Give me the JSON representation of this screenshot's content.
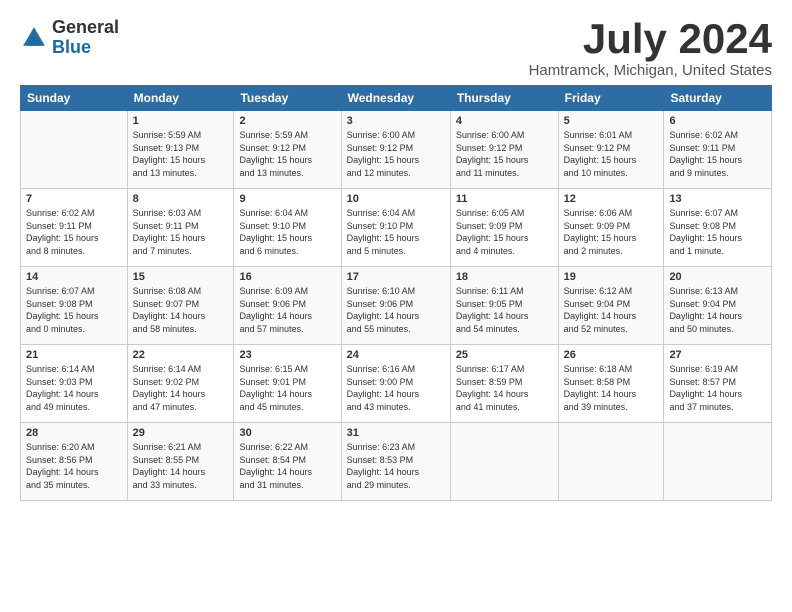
{
  "header": {
    "logo_general": "General",
    "logo_blue": "Blue",
    "month_title": "July 2024",
    "location": "Hamtramck, Michigan, United States"
  },
  "days_of_week": [
    "Sunday",
    "Monday",
    "Tuesday",
    "Wednesday",
    "Thursday",
    "Friday",
    "Saturday"
  ],
  "weeks": [
    [
      {
        "day": "",
        "content": ""
      },
      {
        "day": "1",
        "content": "Sunrise: 5:59 AM\nSunset: 9:13 PM\nDaylight: 15 hours\nand 13 minutes."
      },
      {
        "day": "2",
        "content": "Sunrise: 5:59 AM\nSunset: 9:12 PM\nDaylight: 15 hours\nand 13 minutes."
      },
      {
        "day": "3",
        "content": "Sunrise: 6:00 AM\nSunset: 9:12 PM\nDaylight: 15 hours\nand 12 minutes."
      },
      {
        "day": "4",
        "content": "Sunrise: 6:00 AM\nSunset: 9:12 PM\nDaylight: 15 hours\nand 11 minutes."
      },
      {
        "day": "5",
        "content": "Sunrise: 6:01 AM\nSunset: 9:12 PM\nDaylight: 15 hours\nand 10 minutes."
      },
      {
        "day": "6",
        "content": "Sunrise: 6:02 AM\nSunset: 9:11 PM\nDaylight: 15 hours\nand 9 minutes."
      }
    ],
    [
      {
        "day": "7",
        "content": "Sunrise: 6:02 AM\nSunset: 9:11 PM\nDaylight: 15 hours\nand 8 minutes."
      },
      {
        "day": "8",
        "content": "Sunrise: 6:03 AM\nSunset: 9:11 PM\nDaylight: 15 hours\nand 7 minutes."
      },
      {
        "day": "9",
        "content": "Sunrise: 6:04 AM\nSunset: 9:10 PM\nDaylight: 15 hours\nand 6 minutes."
      },
      {
        "day": "10",
        "content": "Sunrise: 6:04 AM\nSunset: 9:10 PM\nDaylight: 15 hours\nand 5 minutes."
      },
      {
        "day": "11",
        "content": "Sunrise: 6:05 AM\nSunset: 9:09 PM\nDaylight: 15 hours\nand 4 minutes."
      },
      {
        "day": "12",
        "content": "Sunrise: 6:06 AM\nSunset: 9:09 PM\nDaylight: 15 hours\nand 2 minutes."
      },
      {
        "day": "13",
        "content": "Sunrise: 6:07 AM\nSunset: 9:08 PM\nDaylight: 15 hours\nand 1 minute."
      }
    ],
    [
      {
        "day": "14",
        "content": "Sunrise: 6:07 AM\nSunset: 9:08 PM\nDaylight: 15 hours\nand 0 minutes."
      },
      {
        "day": "15",
        "content": "Sunrise: 6:08 AM\nSunset: 9:07 PM\nDaylight: 14 hours\nand 58 minutes."
      },
      {
        "day": "16",
        "content": "Sunrise: 6:09 AM\nSunset: 9:06 PM\nDaylight: 14 hours\nand 57 minutes."
      },
      {
        "day": "17",
        "content": "Sunrise: 6:10 AM\nSunset: 9:06 PM\nDaylight: 14 hours\nand 55 minutes."
      },
      {
        "day": "18",
        "content": "Sunrise: 6:11 AM\nSunset: 9:05 PM\nDaylight: 14 hours\nand 54 minutes."
      },
      {
        "day": "19",
        "content": "Sunrise: 6:12 AM\nSunset: 9:04 PM\nDaylight: 14 hours\nand 52 minutes."
      },
      {
        "day": "20",
        "content": "Sunrise: 6:13 AM\nSunset: 9:04 PM\nDaylight: 14 hours\nand 50 minutes."
      }
    ],
    [
      {
        "day": "21",
        "content": "Sunrise: 6:14 AM\nSunset: 9:03 PM\nDaylight: 14 hours\nand 49 minutes."
      },
      {
        "day": "22",
        "content": "Sunrise: 6:14 AM\nSunset: 9:02 PM\nDaylight: 14 hours\nand 47 minutes."
      },
      {
        "day": "23",
        "content": "Sunrise: 6:15 AM\nSunset: 9:01 PM\nDaylight: 14 hours\nand 45 minutes."
      },
      {
        "day": "24",
        "content": "Sunrise: 6:16 AM\nSunset: 9:00 PM\nDaylight: 14 hours\nand 43 minutes."
      },
      {
        "day": "25",
        "content": "Sunrise: 6:17 AM\nSunset: 8:59 PM\nDaylight: 14 hours\nand 41 minutes."
      },
      {
        "day": "26",
        "content": "Sunrise: 6:18 AM\nSunset: 8:58 PM\nDaylight: 14 hours\nand 39 minutes."
      },
      {
        "day": "27",
        "content": "Sunrise: 6:19 AM\nSunset: 8:57 PM\nDaylight: 14 hours\nand 37 minutes."
      }
    ],
    [
      {
        "day": "28",
        "content": "Sunrise: 6:20 AM\nSunset: 8:56 PM\nDaylight: 14 hours\nand 35 minutes."
      },
      {
        "day": "29",
        "content": "Sunrise: 6:21 AM\nSunset: 8:55 PM\nDaylight: 14 hours\nand 33 minutes."
      },
      {
        "day": "30",
        "content": "Sunrise: 6:22 AM\nSunset: 8:54 PM\nDaylight: 14 hours\nand 31 minutes."
      },
      {
        "day": "31",
        "content": "Sunrise: 6:23 AM\nSunset: 8:53 PM\nDaylight: 14 hours\nand 29 minutes."
      },
      {
        "day": "",
        "content": ""
      },
      {
        "day": "",
        "content": ""
      },
      {
        "day": "",
        "content": ""
      }
    ]
  ]
}
